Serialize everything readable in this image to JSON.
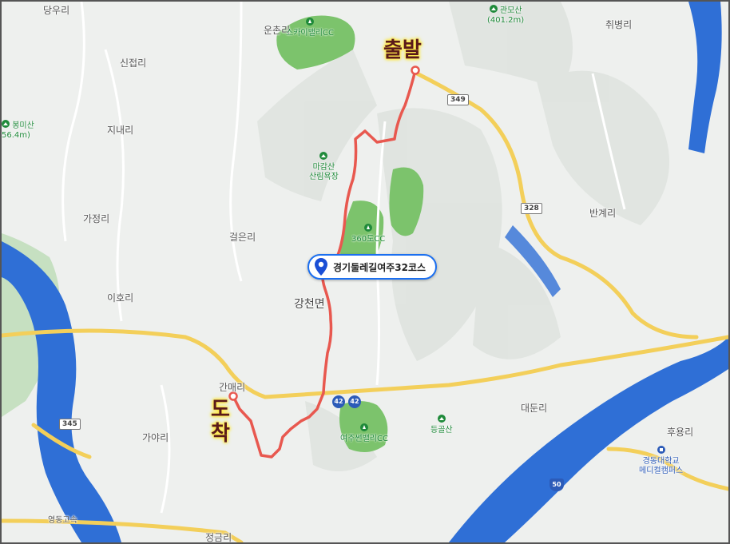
{
  "markers": {
    "start_label": "출발",
    "end_label_1": "도",
    "end_label_2": "착"
  },
  "course_badge": {
    "label": "경기둘레길여주32코스"
  },
  "places": {
    "danguri": "당우리",
    "unchonri": "운촌리",
    "sinjeopri": "신접리",
    "jinaeri": "지내리",
    "gajeongri": "가정리",
    "georeunri": "걸은리",
    "iholi": "이호리",
    "gangcheonmyeon": "강천면",
    "ganmaeri": "간매리",
    "gayari": "가야리",
    "daedunri": "대둔리",
    "huyongri": "후용리",
    "chwibyeongri": "취병리",
    "bangyeri": "반계리",
    "jeonggeumri": "정금리"
  },
  "pois": {
    "skyvalley": "스카이밸리CC",
    "gwanmosan_name": "관모산",
    "gwanmosan_height": "(401.2m)",
    "magamsan_1": "마감산",
    "magamsan_2": "산림욕장",
    "cc360": "360도CC",
    "yeojuvalley": "여주썬밸리CC",
    "deunggolsan": "등골산",
    "left_mountain_1": "봉미산",
    "left_mountain_2": "56.4m)",
    "univ_1": "경동대학교",
    "univ_2": "메디컬캠퍼스"
  },
  "roads": {
    "r349": "349",
    "r328": "328",
    "r345": "345",
    "r42a": "42",
    "r42b": "42",
    "r50": "50",
    "expressway": "영동고속"
  },
  "colors": {
    "route": "#e8584f",
    "water": "#2f6fd6",
    "forest": "#6fbe63",
    "highway": "#f3cf5a",
    "badge_border": "#1b6ff0"
  }
}
